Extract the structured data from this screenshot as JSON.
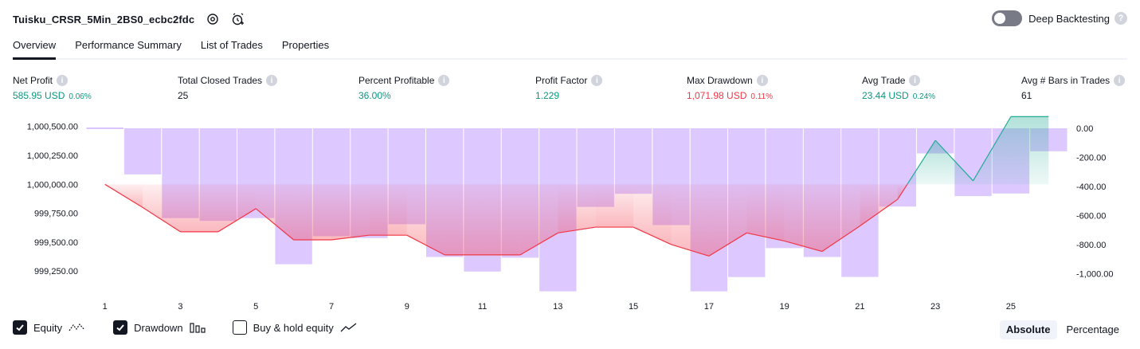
{
  "header": {
    "strategy_name": "Tuisku_CRSR_5Min_2BS0_ecbc2fdc",
    "deep_backtesting_label": "Deep Backtesting",
    "deep_backtesting_enabled": false
  },
  "tabs": [
    {
      "label": "Overview",
      "active": true
    },
    {
      "label": "Performance Summary",
      "active": false
    },
    {
      "label": "List of Trades",
      "active": false
    },
    {
      "label": "Properties",
      "active": false
    }
  ],
  "metrics": [
    {
      "label": "Net Profit",
      "value": "585.95 USD",
      "pct": "0.06%",
      "color": "green"
    },
    {
      "label": "Total Closed Trades",
      "value": "25",
      "pct": "",
      "color": "dark"
    },
    {
      "label": "Percent Profitable",
      "value": "36.00%",
      "pct": "",
      "color": "green"
    },
    {
      "label": "Profit Factor",
      "value": "1.229",
      "pct": "",
      "color": "green"
    },
    {
      "label": "Max Drawdown",
      "value": "1,071.98 USD",
      "pct": "0.11%",
      "color": "red"
    },
    {
      "label": "Avg Trade",
      "value": "23.44 USD",
      "pct": "0.24%",
      "color": "green"
    },
    {
      "label": "Avg # Bars in Trades",
      "value": "61",
      "pct": "",
      "color": "dark"
    }
  ],
  "chart_data": {
    "type": "line",
    "x": [
      1,
      2,
      3,
      4,
      5,
      6,
      7,
      8,
      9,
      10,
      11,
      12,
      13,
      14,
      15,
      16,
      17,
      18,
      19,
      20,
      21,
      22,
      23,
      24,
      25,
      26
    ],
    "x_tick_labels": [
      "1",
      "3",
      "5",
      "7",
      "9",
      "11",
      "13",
      "15",
      "17",
      "19",
      "21",
      "23",
      "25"
    ],
    "left_axis": {
      "ticks": [
        "1,000,500.00",
        "1,000,250.00",
        "1,000,000.00",
        "999,750.00",
        "999,500.00",
        "999,250.00"
      ],
      "ylim": [
        999100,
        1000560
      ]
    },
    "right_axis": {
      "ticks": [
        "0.00",
        "-200.00",
        "-400.00",
        "-600.00",
        "-800.00",
        "-1,000.00"
      ],
      "ylim": [
        -1100,
        60
      ]
    },
    "series": [
      {
        "name": "Equity",
        "type": "line",
        "values": [
          1000000,
          999800,
          999590,
          999590,
          999790,
          999520,
          999520,
          999560,
          999560,
          999390,
          999390,
          999390,
          999580,
          999630,
          999630,
          999480,
          999380,
          999580,
          999510,
          999420,
          999640,
          999870,
          1000380,
          1000030,
          1000585,
          1000585
        ]
      },
      {
        "name": "Drawdown",
        "type": "bar",
        "values": [
          0,
          -317,
          -617,
          -636,
          -617,
          -934,
          -741,
          -754,
          -659,
          -884,
          -984,
          -889,
          -1120,
          -540,
          -450,
          -665,
          -1120,
          -1022,
          -823,
          -884,
          -1021,
          -538,
          -173,
          -466,
          -448,
          -158
        ]
      }
    ],
    "colors": {
      "drawdown": "#b388ff",
      "equity_loss_line": "#f23645",
      "equity_gain_line": "#22ab94"
    }
  },
  "legend": {
    "equity_label": "Equity",
    "equity_checked": true,
    "drawdown_label": "Drawdown",
    "drawdown_checked": true,
    "buyhold_label": "Buy & hold equity",
    "buyhold_checked": false
  },
  "view_toggle": {
    "absolute_label": "Absolute",
    "percentage_label": "Percentage",
    "selected": "Absolute"
  }
}
